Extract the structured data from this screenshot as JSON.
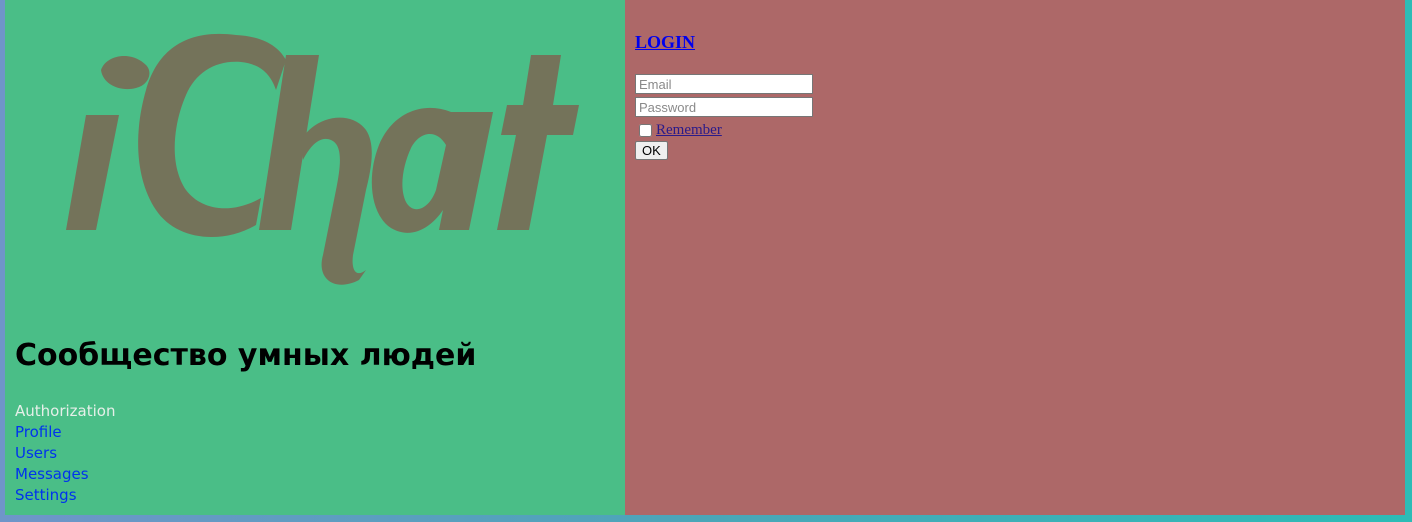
{
  "brand": {
    "logo_text": "iChat",
    "logo_color": "#74735a"
  },
  "slogan": "Сообщество умных людей",
  "nav": {
    "items": [
      {
        "label": "Authorization",
        "active": true
      },
      {
        "label": "Profile",
        "active": false
      },
      {
        "label": "Users",
        "active": false
      },
      {
        "label": "Messages",
        "active": false
      },
      {
        "label": "Settings",
        "active": false
      }
    ]
  },
  "login": {
    "title": "LOGIN",
    "email_placeholder": "Email",
    "password_placeholder": "Password",
    "remember_label": " Remember",
    "ok_label": "OK"
  },
  "colors": {
    "left_panel": "#4abe87",
    "right_panel": "#ad6868",
    "link": "#0033ee",
    "active_link": "#e6efe9"
  }
}
